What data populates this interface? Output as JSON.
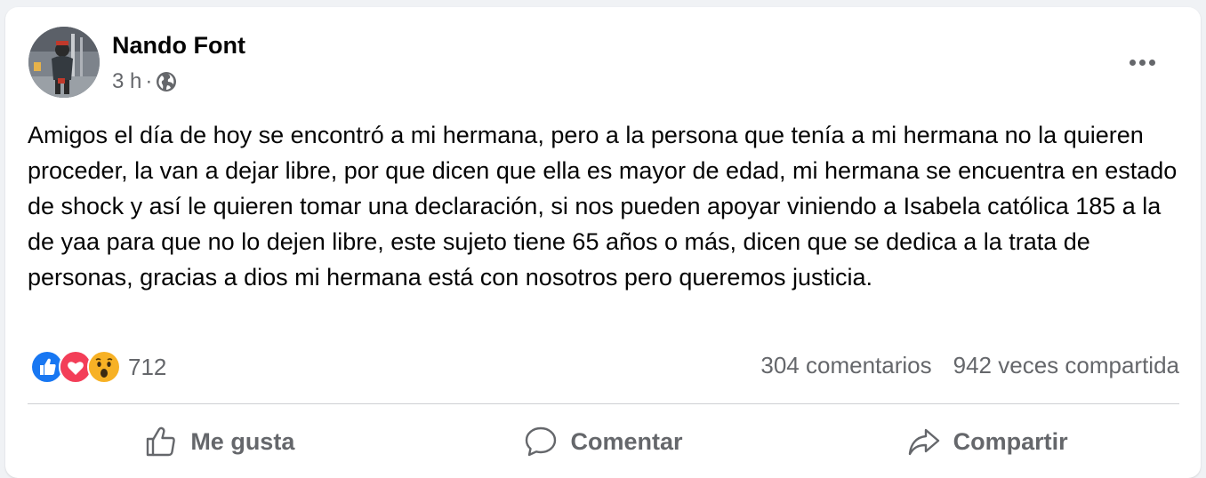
{
  "post": {
    "author": "Nando Font",
    "time": "3 h",
    "separator": "·",
    "privacy_icon": "globe-icon",
    "text": "Amigos el día de hoy se encontró a mi hermana, pero a la persona que tenía a mi hermana no la quieren proceder, la van a dejar libre, por que dicen que ella es mayor de edad, mi hermana se encuentra en estado de shock y así le quieren tomar una declaración, si nos pueden apoyar viniendo a Isabela católica 185 a la de yaa para que no lo dejen libre, este sujeto tiene 65 años o más, dicen que se dedica a la trata de personas, gracias a dios mi hermana está con nosotros pero queremos justicia."
  },
  "reactions": {
    "icons": [
      "like-icon",
      "love-icon",
      "wow-icon"
    ],
    "count": "712",
    "comments": "304 comentarios",
    "shares": "942 veces compartida"
  },
  "actions": {
    "like": "Me gusta",
    "comment": "Comentar",
    "share": "Compartir"
  },
  "colors": {
    "like": "#1877f2",
    "love": "#f33e58",
    "wow": "#f7b125",
    "secondary_text": "#65676b"
  }
}
